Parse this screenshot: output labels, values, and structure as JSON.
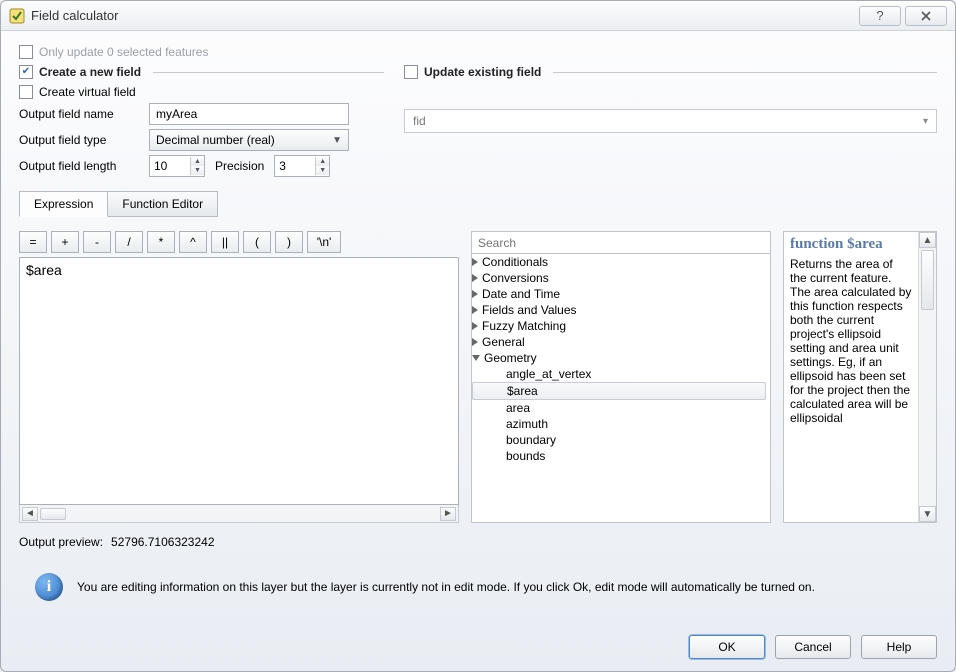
{
  "window": {
    "title": "Field calculator"
  },
  "options": {
    "only_update_label": "Only update 0 selected features",
    "create_new_field_label": "Create a new field",
    "create_virtual_field_label": "Create virtual field",
    "update_existing_field_label": "Update existing field"
  },
  "new_field": {
    "name_label": "Output field name",
    "name_value": "myArea",
    "type_label": "Output field type",
    "type_value": "Decimal number (real)",
    "length_label": "Output field length",
    "length_value": "10",
    "precision_label": "Precision",
    "precision_value": "3"
  },
  "update_field": {
    "selected": "fid"
  },
  "tabs": {
    "expression": "Expression",
    "function_editor": "Function Editor"
  },
  "operators": [
    "=",
    "+",
    "-",
    "/",
    "*",
    "^",
    "||",
    "(",
    ")",
    "'\\n'"
  ],
  "expression_text": "$area",
  "search_placeholder": "Search",
  "tree": {
    "collapsed": [
      "Conditionals",
      "Conversions",
      "Date and Time",
      "Fields and Values",
      "Fuzzy Matching",
      "General"
    ],
    "open_group": "Geometry",
    "children": [
      "angle_at_vertex",
      "$area",
      "area",
      "azimuth",
      "boundary",
      "bounds"
    ],
    "selected": "$area"
  },
  "help": {
    "title": "function $area",
    "body": "Returns the area of the current feature. The area calculated by this function respects both the current project's ellipsoid setting and area unit settings. Eg, if an ellipsoid has been set for the project then the calculated area will be ellipsoidal"
  },
  "preview": {
    "label": "Output preview:",
    "value": "52796.7106323242"
  },
  "info_message": "You are editing information on this layer but the layer is currently not in edit mode. If you click Ok, edit mode will automatically be turned on.",
  "buttons": {
    "ok": "OK",
    "cancel": "Cancel",
    "help": "Help"
  }
}
